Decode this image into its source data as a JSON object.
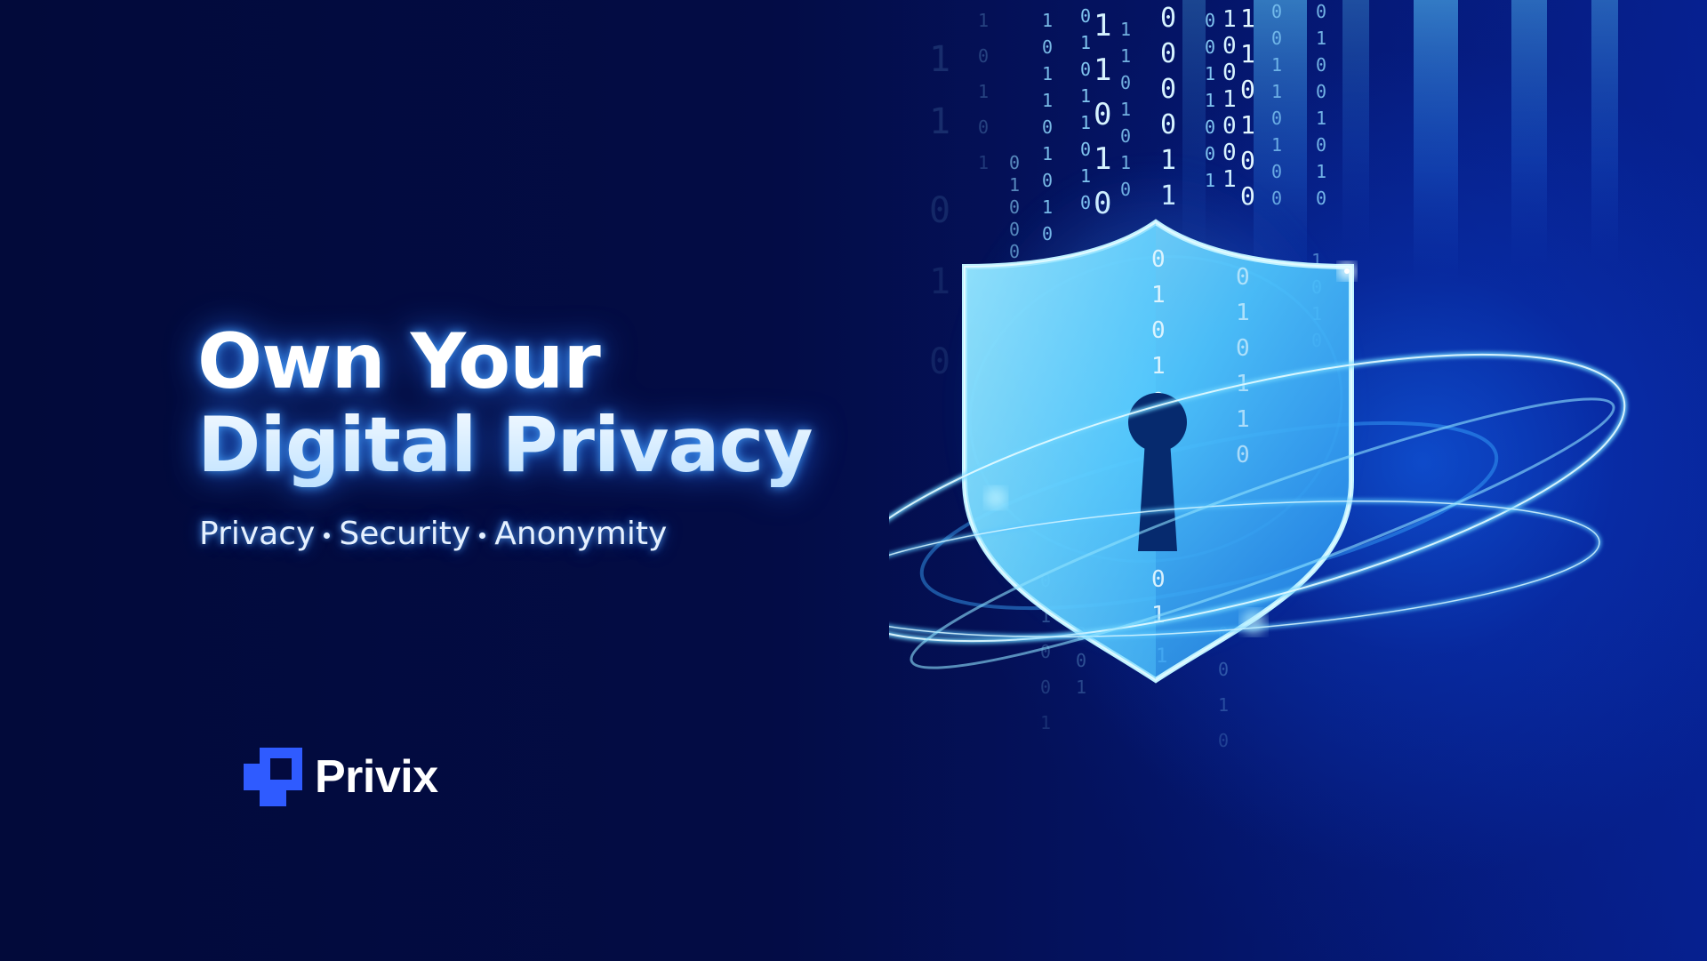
{
  "hero": {
    "headline_line1": "Own Your",
    "headline_line2": "Digital Privacy",
    "tagline": {
      "items": [
        "Privacy",
        "Security",
        "Anonymity"
      ]
    }
  },
  "brand": {
    "name": "Privix",
    "accent_color": "#2f5bff"
  },
  "illustration": {
    "subject": "shield-with-keyhole",
    "background_color": "#030a3f",
    "glow_color": "#39c8ff"
  }
}
